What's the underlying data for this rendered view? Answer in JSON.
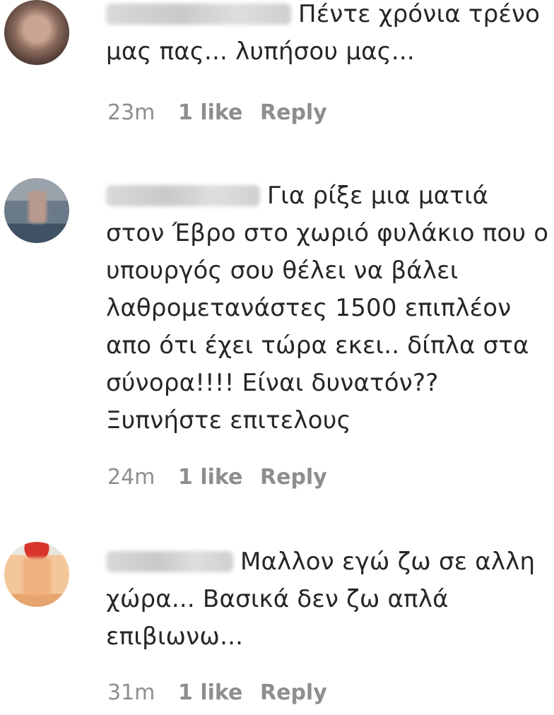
{
  "comments": [
    {
      "text": "Πέντε χρόνια τρένο μας πας... λυπήσου μας...",
      "time": "23m",
      "likes": "1 like",
      "reply": "Reply"
    },
    {
      "text": "Για ρίξε μια ματιά στον Έβρο στο χωριό φυλάκιο που ο υπουργός σου θέλει να βάλει λαθρομετανάστες 1500 επιπλέον απο ότι έχει τώρα εκει.. δίπλα στα σύνορα!!!! Είναι δυνατόν?? Ξυπνήστε επιτελους",
      "time": "24m",
      "likes": "1 like",
      "reply": "Reply"
    },
    {
      "text": "Μαλλον εγώ ζω σε αλλη χώρα... Βασικά δεν ζω απλά επιβιωνω...",
      "time": "31m",
      "likes": "1 like",
      "reply": "Reply"
    }
  ]
}
